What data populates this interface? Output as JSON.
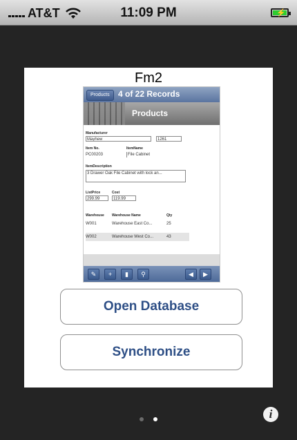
{
  "status_bar": {
    "carrier": "AT&T",
    "time": "11:09 PM",
    "battery_charging": true
  },
  "card": {
    "title": "Fm2"
  },
  "thumbnail": {
    "nav": {
      "back_label": "Products",
      "records": "4 of 22 Records"
    },
    "banner_title": "Products",
    "manufacturer_label": "Manufacturer",
    "manufacturer_value": "Mayhew",
    "manufacturer_code": "1261",
    "item_no_label": "Item No.",
    "item_no_value": "PC00203",
    "item_name_label": "ItemName",
    "item_name_value": "File Cabinet",
    "description_label": "ItemDescription",
    "description_value": "3 Drawer Oak File Cabinet with lock an...",
    "list_price_label": "ListPrice",
    "list_price_value": "299.99",
    "cost_label": "Cost",
    "cost_value": "119.99",
    "table_headers": [
      "Warehouse",
      "Warehouse Name",
      "Qty"
    ],
    "rows": [
      [
        "W001",
        "Warehouse East Co...",
        "25"
      ],
      [
        "W002",
        "Warehouse West Co...",
        "43"
      ]
    ]
  },
  "buttons": {
    "open_database": "Open Database",
    "synchronize": "Synchronize"
  },
  "page_indicator": {
    "pages": 2,
    "current": 2
  },
  "icons": {
    "wifi": "wifi-icon",
    "info": "info-icon",
    "battery": "battery-icon"
  },
  "colors": {
    "button_text": "#2e4f86",
    "nav_blue": "#5a74a0",
    "background": "#242424"
  }
}
